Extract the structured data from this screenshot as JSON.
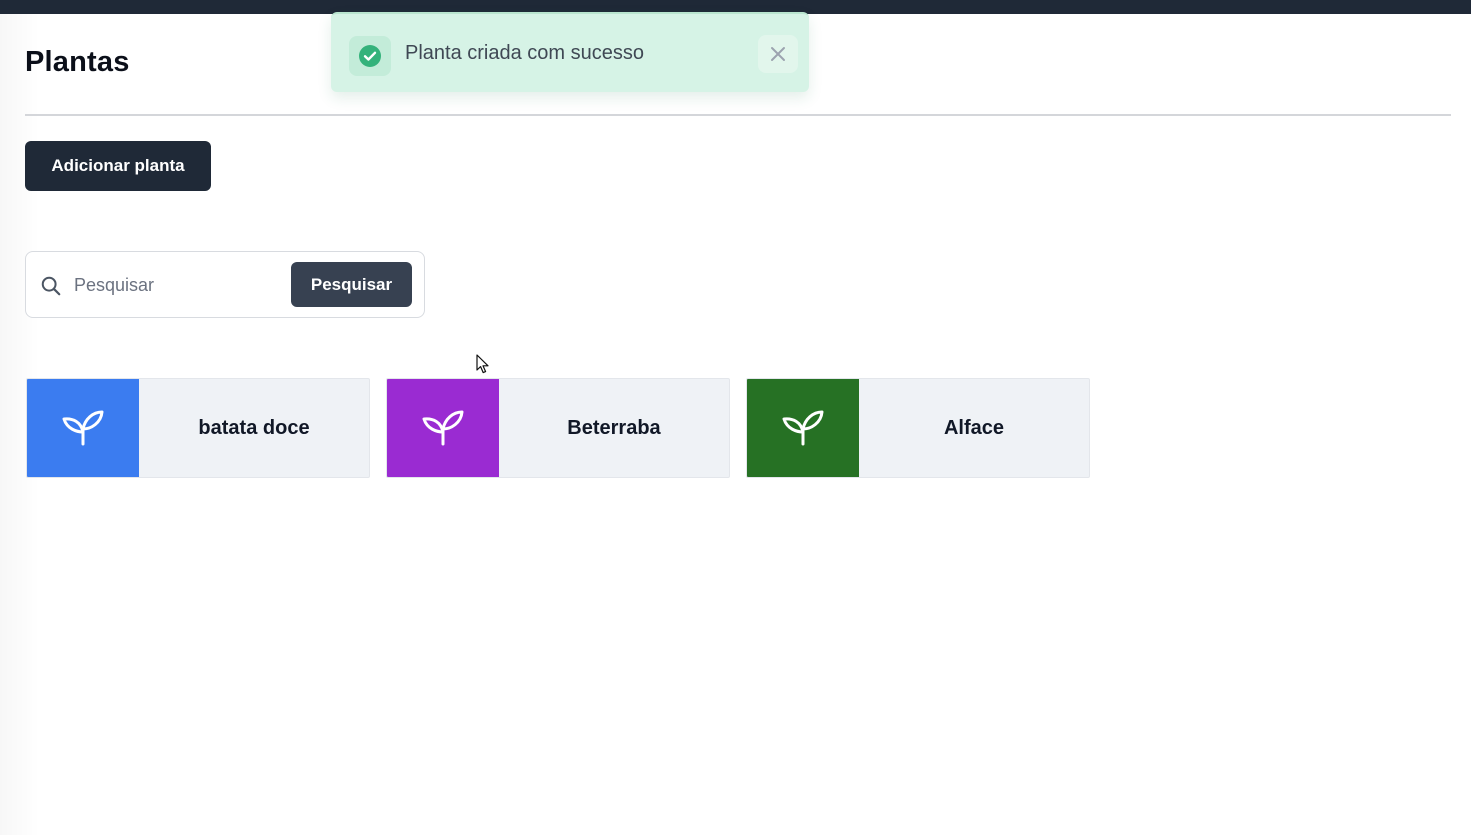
{
  "page": {
    "title": "Plantas"
  },
  "toolbar": {
    "add_label": "Adicionar planta"
  },
  "search": {
    "placeholder": "Pesquisar",
    "value": "",
    "button_label": "Pesquisar",
    "icon": "search-icon"
  },
  "plants": [
    {
      "name": "batata doce",
      "color": "#3b7cf0",
      "icon": "sprout-icon"
    },
    {
      "name": "Beterraba",
      "color": "#9a2bd2",
      "icon": "sprout-icon"
    },
    {
      "name": "Alface",
      "color": "#267124",
      "icon": "sprout-icon"
    }
  ],
  "toast": {
    "message": "Planta criada com sucesso",
    "status": "success",
    "status_color": "#34b27b",
    "icon": "check-circle-icon",
    "close_icon": "close-icon"
  },
  "colors": {
    "top_bar": "#1f2937",
    "primary_button": "#1f2937",
    "search_button": "#374151",
    "card_background": "#eff2f6"
  }
}
